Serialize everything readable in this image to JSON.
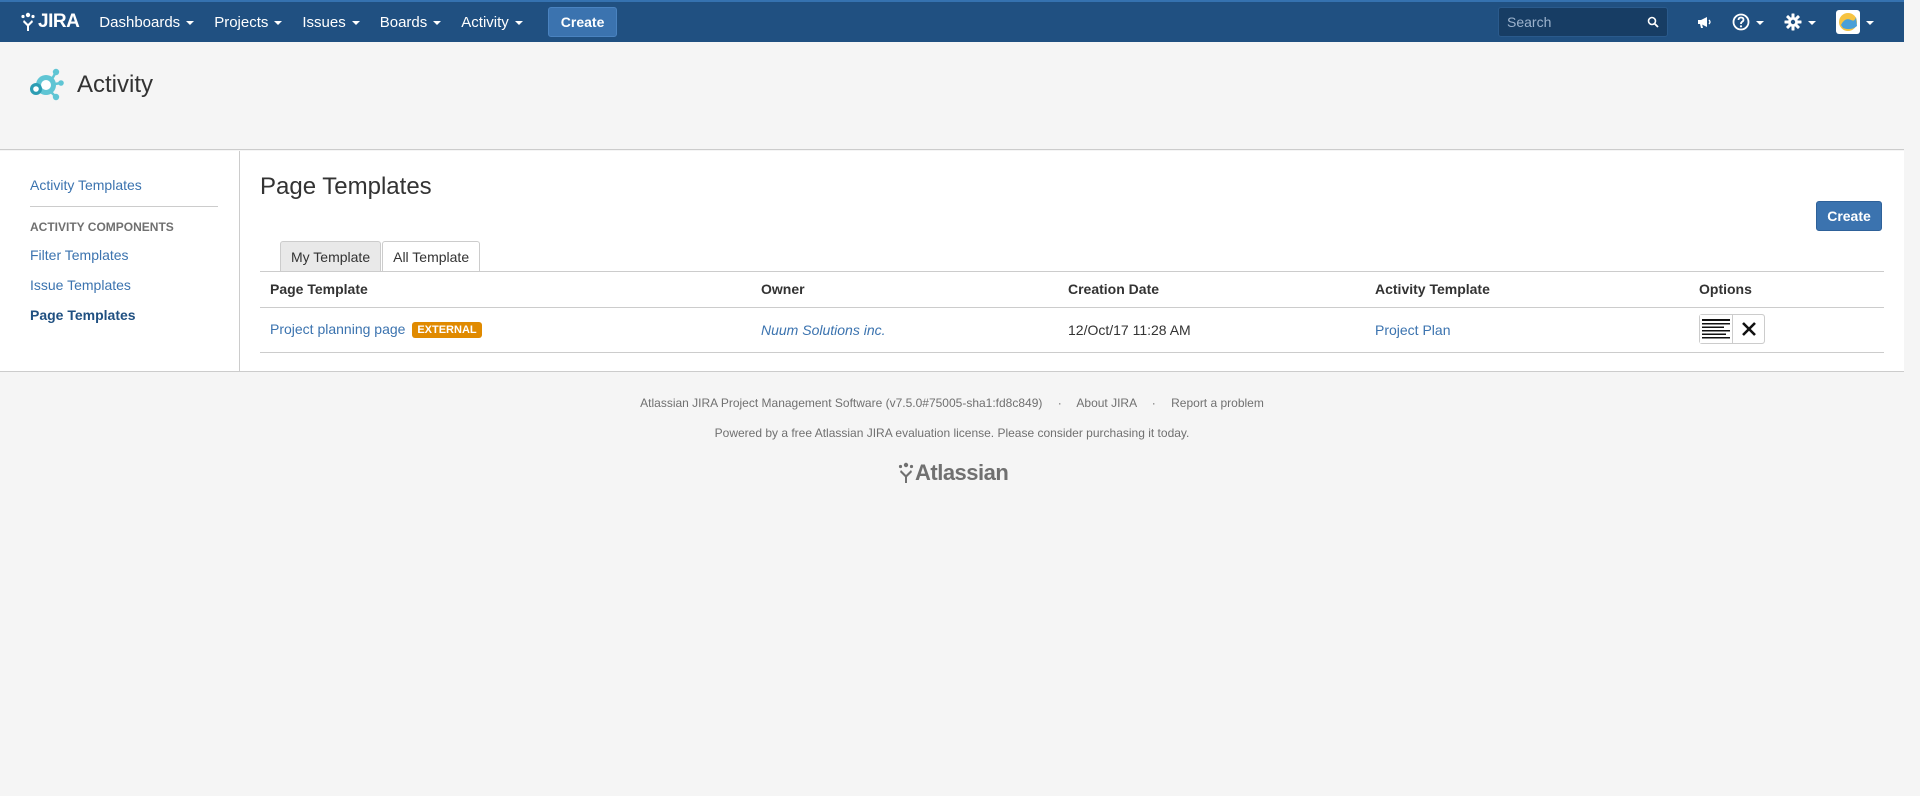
{
  "header": {
    "logo_text": "JIRA",
    "nav": [
      {
        "label": "Dashboards"
      },
      {
        "label": "Projects"
      },
      {
        "label": "Issues"
      },
      {
        "label": "Boards"
      },
      {
        "label": "Activity"
      }
    ],
    "create_label": "Create",
    "search_placeholder": "Search"
  },
  "page": {
    "title": "Activity"
  },
  "sidebar": {
    "activity_templates": "Activity Templates",
    "components_heading": "ACTIVITY COMPONENTS",
    "filter_templates": "Filter Templates",
    "issue_templates": "Issue Templates",
    "page_templates": "Page Templates"
  },
  "main": {
    "title": "Page Templates",
    "create_label": "Create",
    "tabs": [
      {
        "label": "My Template",
        "active": false
      },
      {
        "label": "All Template",
        "active": true
      }
    ],
    "columns": [
      "Page Template",
      "Owner",
      "Creation Date",
      "Activity Template",
      "Options"
    ],
    "rows": [
      {
        "page_template": "Project planning page",
        "badge": "EXTERNAL",
        "owner": "Nuum Solutions inc.",
        "creation_date": "12/Oct/17 11:28 AM",
        "activity_template": "Project Plan"
      }
    ]
  },
  "footer": {
    "software": "Atlassian JIRA Project Management Software (v7.5.0#75005-sha1:fd8c849)",
    "about": "About JIRA",
    "report": "Report a problem",
    "license": "Powered by a free Atlassian JIRA evaluation license. Please consider purchasing it today.",
    "atlassian_logo": "Atlassian"
  },
  "colors": {
    "header_bg": "#205081",
    "link": "#3b73af",
    "badge": "#e08a00"
  }
}
